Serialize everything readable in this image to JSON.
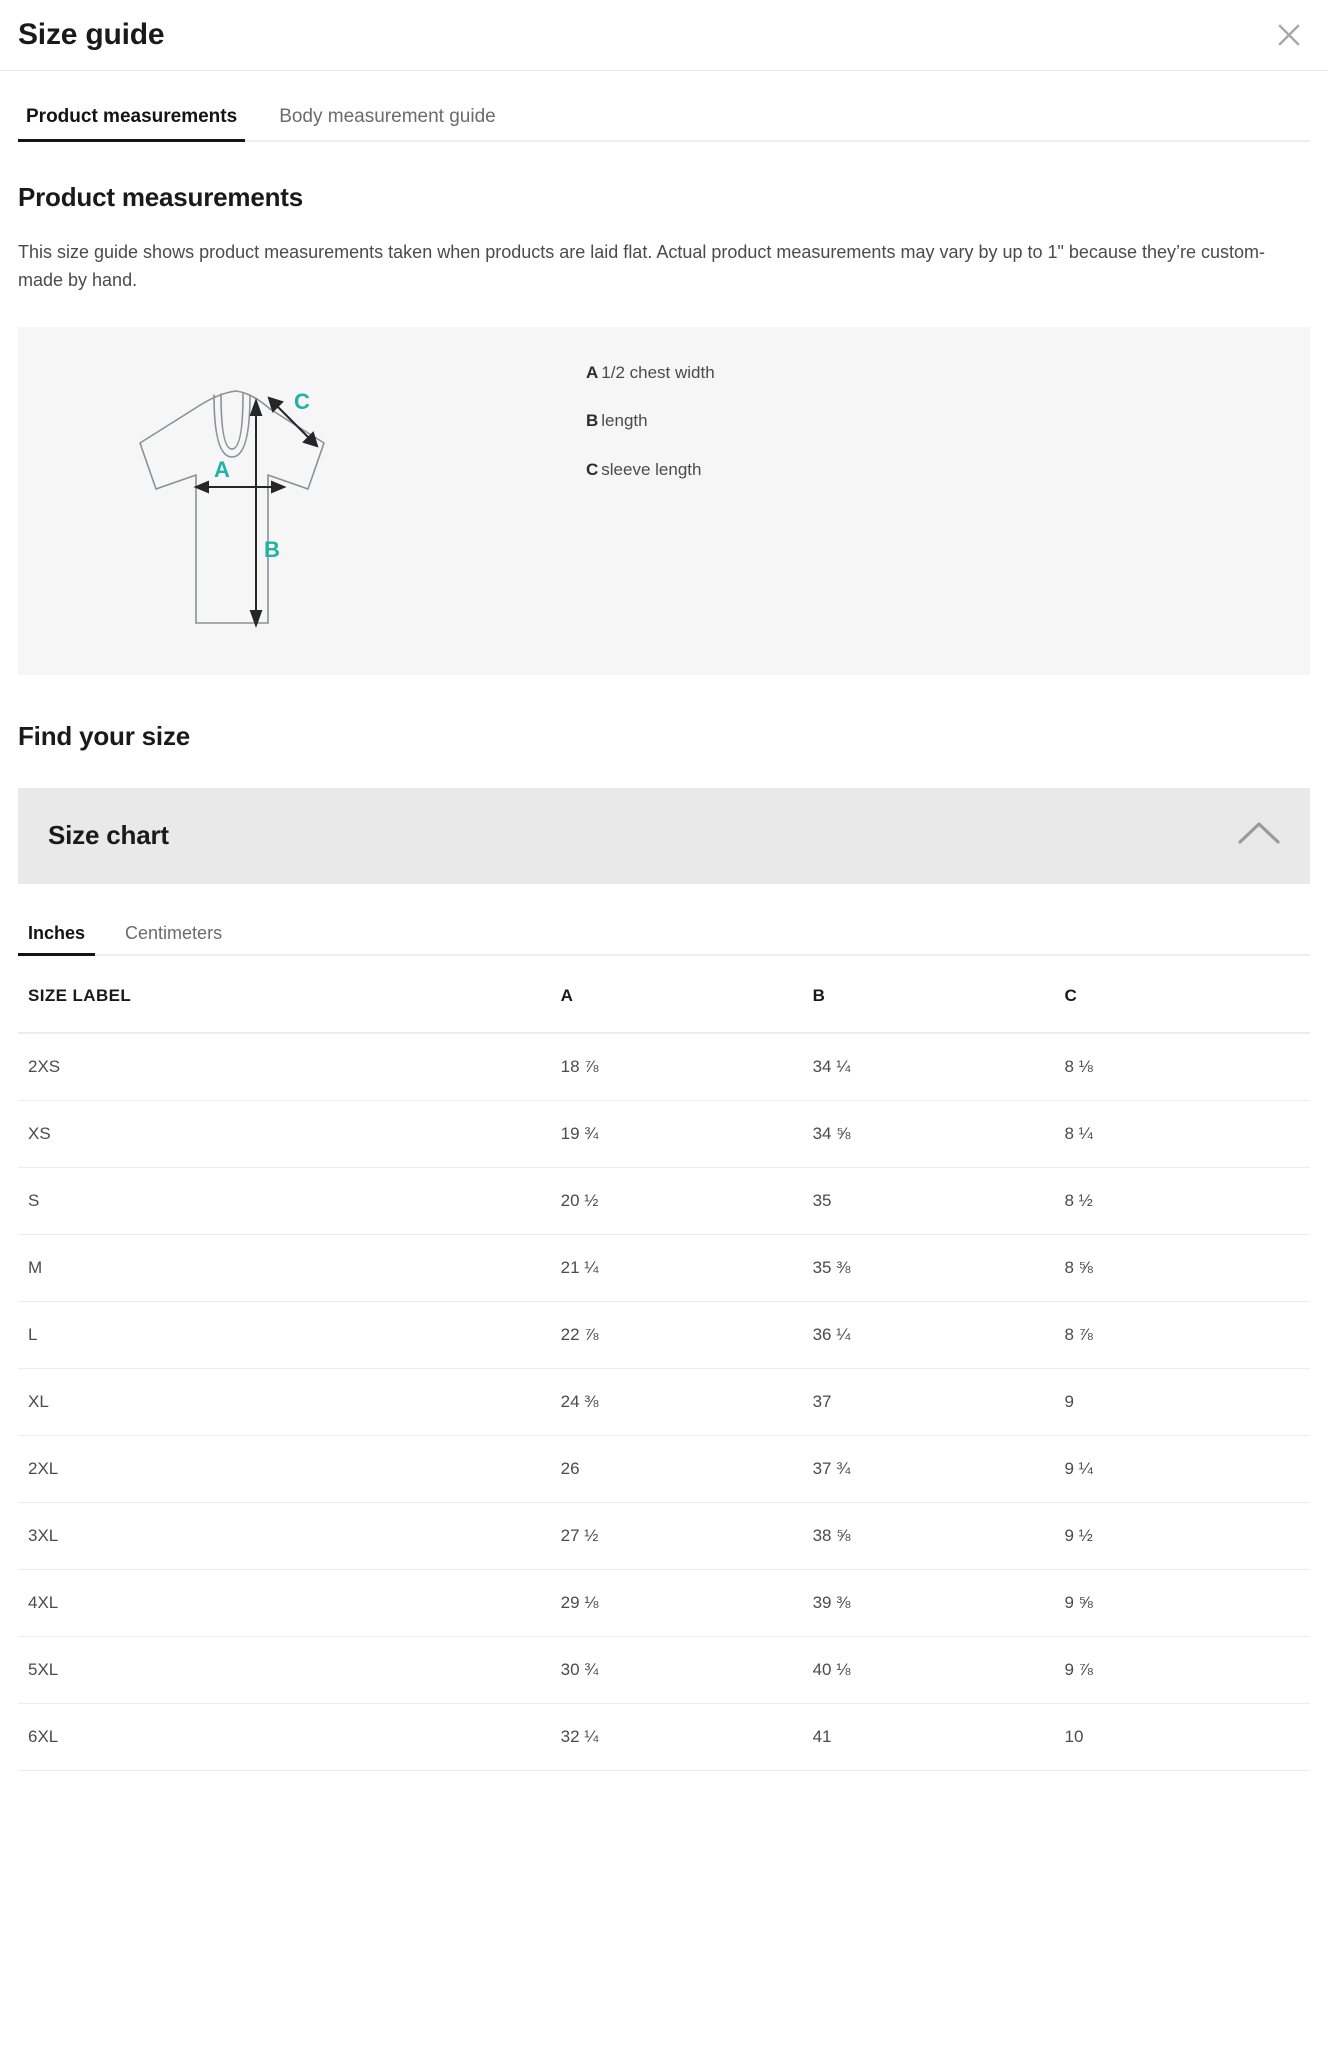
{
  "modal": {
    "title": "Size guide",
    "close_icon": "close-icon"
  },
  "tabs": [
    {
      "label": "Product measurements",
      "active": true
    },
    {
      "label": "Body measurement guide",
      "active": false
    }
  ],
  "product_measurements": {
    "heading": "Product measurements",
    "description": "This size guide shows product measurements taken when products are laid flat. Actual product measurements may vary by up to 1\" because they’re custom-made by hand.",
    "diagram": {
      "marker_color": "#1FB2A6",
      "outline_color": "#8a9199",
      "background": "#f6f6f6",
      "markers": [
        "A",
        "B",
        "C"
      ],
      "legend": [
        {
          "key": "A",
          "text": "1/2 chest width"
        },
        {
          "key": "B",
          "text": "length"
        },
        {
          "key": "C",
          "text": "sleeve length"
        }
      ]
    }
  },
  "find_your_size": {
    "heading": "Find your size",
    "accordion": {
      "title": "Size chart",
      "expanded": true,
      "chevron_icon": "chevron-up-icon"
    },
    "unit_tabs": [
      {
        "label": "Inches",
        "active": true
      },
      {
        "label": "Centimeters",
        "active": false
      }
    ]
  },
  "size_chart": {
    "columns": [
      "SIZE LABEL",
      "A",
      "B",
      "C"
    ],
    "rows": [
      {
        "size": "2XS",
        "a": "18 ⅞",
        "b": "34 ¼",
        "c": "8 ⅛"
      },
      {
        "size": "XS",
        "a": "19 ¾",
        "b": "34 ⅝",
        "c": "8 ¼"
      },
      {
        "size": "S",
        "a": "20 ½",
        "b": "35",
        "c": "8 ½"
      },
      {
        "size": "M",
        "a": "21 ¼",
        "b": "35 ⅜",
        "c": "8 ⅝"
      },
      {
        "size": "L",
        "a": "22 ⅞",
        "b": "36 ¼",
        "c": "8 ⅞"
      },
      {
        "size": "XL",
        "a": "24 ⅜",
        "b": "37",
        "c": "9"
      },
      {
        "size": "2XL",
        "a": "26",
        "b": "37 ¾",
        "c": "9 ¼"
      },
      {
        "size": "3XL",
        "a": "27 ½",
        "b": "38 ⅝",
        "c": "9 ½"
      },
      {
        "size": "4XL",
        "a": "29 ⅛",
        "b": "39 ⅜",
        "c": "9 ⅝"
      },
      {
        "size": "5XL",
        "a": "30 ¾",
        "b": "40 ⅛",
        "c": "9 ⅞"
      },
      {
        "size": "6XL",
        "a": "32 ¼",
        "b": "41",
        "c": "10"
      }
    ]
  }
}
